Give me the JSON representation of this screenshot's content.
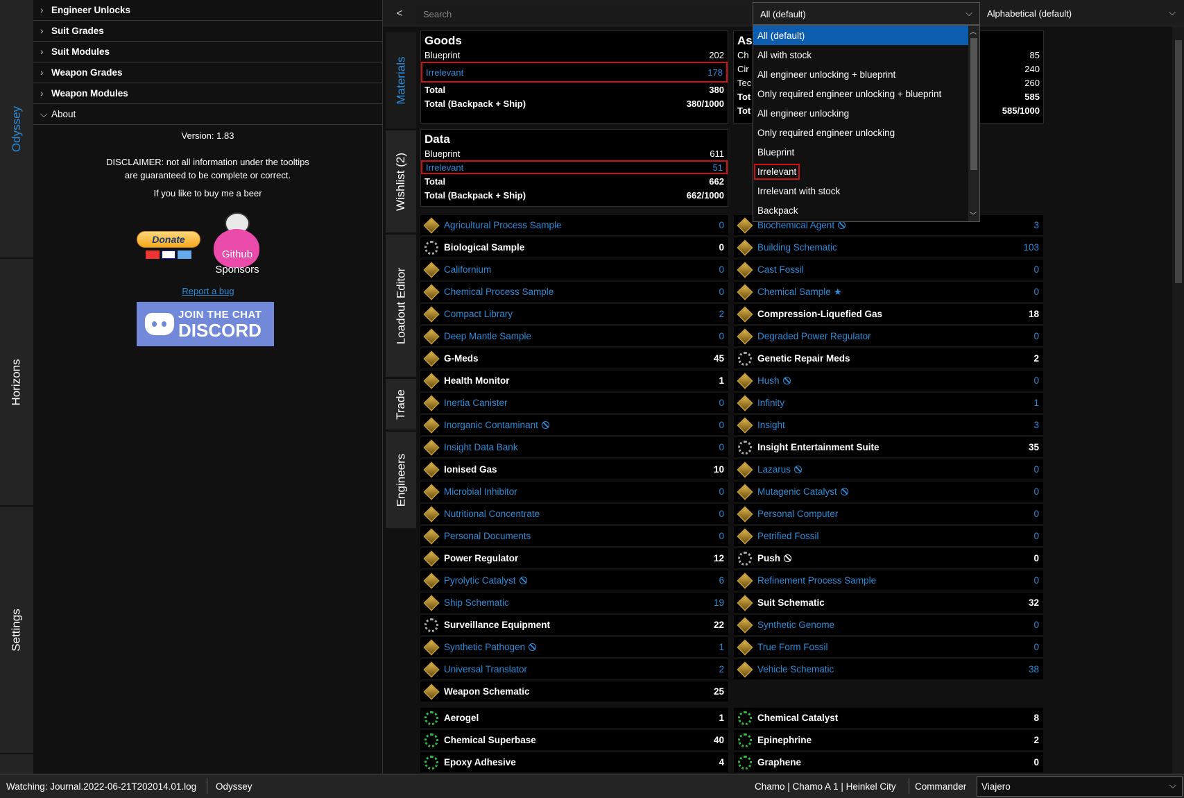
{
  "left_tabs": [
    "Odyssey",
    "Horizons",
    "Settings"
  ],
  "accordion": [
    {
      "label": "Engineer Unlocks",
      "open": false
    },
    {
      "label": "Suit Grades",
      "open": false
    },
    {
      "label": "Suit Modules",
      "open": false
    },
    {
      "label": "Weapon Grades",
      "open": false
    },
    {
      "label": "Weapon Modules",
      "open": false
    },
    {
      "label": "About",
      "open": true
    }
  ],
  "about": {
    "version": "Version: 1.83",
    "disclaimer1": "DISCLAIMER: not all information under the tooltips",
    "disclaimer2": "are guaranteed to be complete or correct.",
    "beer": "If you like to buy me a beer",
    "donate": "Donate",
    "github": "Github",
    "sponsors": "Sponsors",
    "report": "Report a bug",
    "discord1": "JOIN THE CHAT",
    "discord2": "DISCORD"
  },
  "topbar": {
    "back": "<",
    "search_placeholder": "Search",
    "filter": "All (default)",
    "sort": "Alphabetical (default)"
  },
  "mid_tabs": [
    "Materials",
    "Wishlist (2)",
    "Loadout Editor",
    "Trade",
    "Engineers"
  ],
  "goods": {
    "title": "Goods",
    "rows": [
      {
        "label": "Blueprint",
        "value": "202"
      },
      {
        "label": "Irrelevant",
        "value": "178"
      },
      {
        "label": "",
        "value": ""
      },
      {
        "label": "Total",
        "value": "380"
      },
      {
        "label": "Total (Backpack + Ship)",
        "value": "380/1000"
      }
    ]
  },
  "assets": {
    "title": "As",
    "rows": [
      {
        "label": "Ch",
        "value": "85"
      },
      {
        "label": "Cir",
        "value": "240"
      },
      {
        "label": "Tec",
        "value": "260"
      },
      {
        "label": "Tot",
        "value": "585"
      },
      {
        "label": "Tot",
        "value": "585/1000"
      }
    ]
  },
  "data": {
    "title": "Data",
    "rows": [
      {
        "label": "Blueprint",
        "value": "611"
      },
      {
        "label": "Irrelevant",
        "value": "51"
      },
      {
        "label": "Total",
        "value": "662"
      },
      {
        "label": "Total (Backpack + Ship)",
        "value": "662/1000"
      }
    ]
  },
  "dropdown": [
    "All (default)",
    "All with stock",
    "All engineer unlocking + blueprint",
    "Only required engineer unlocking + blueprint",
    "All engineer unlocking",
    "Only required engineer unlocking",
    "Blueprint",
    "Irrelevant",
    "Irrelevant with stock",
    "Backpack"
  ],
  "left_items": [
    {
      "name": "Agricultural Process Sample",
      "count": "0",
      "icon": "cube"
    },
    {
      "name": "Biological Sample",
      "count": "0",
      "icon": "gear",
      "bold": true
    },
    {
      "name": "Californium",
      "count": "0",
      "icon": "cube"
    },
    {
      "name": "Chemical Process Sample",
      "count": "0",
      "icon": "cube"
    },
    {
      "name": "Compact Library",
      "count": "2",
      "icon": "cube"
    },
    {
      "name": "Deep Mantle Sample",
      "count": "0",
      "icon": "cube"
    },
    {
      "name": "G-Meds",
      "count": "45",
      "icon": "cube",
      "bold": true
    },
    {
      "name": "Health Monitor",
      "count": "1",
      "icon": "cube",
      "bold": true
    },
    {
      "name": "Inertia Canister",
      "count": "0",
      "icon": "cube"
    },
    {
      "name": "Inorganic Contaminant",
      "count": "0",
      "icon": "cube",
      "block": true
    },
    {
      "name": "Insight Data Bank",
      "count": "0",
      "icon": "cube"
    },
    {
      "name": "Ionised Gas",
      "count": "10",
      "icon": "cube",
      "bold": true
    },
    {
      "name": "Microbial Inhibitor",
      "count": "0",
      "icon": "cube"
    },
    {
      "name": "Nutritional Concentrate",
      "count": "0",
      "icon": "cube"
    },
    {
      "name": "Personal Documents",
      "count": "0",
      "icon": "cube"
    },
    {
      "name": "Power Regulator",
      "count": "12",
      "icon": "cube",
      "bold": true
    },
    {
      "name": "Pyrolytic Catalyst",
      "count": "6",
      "icon": "cube",
      "block": true
    },
    {
      "name": "Ship Schematic",
      "count": "19",
      "icon": "cube"
    },
    {
      "name": "Surveillance Equipment",
      "count": "22",
      "icon": "gear",
      "bold": true
    },
    {
      "name": "Synthetic Pathogen",
      "count": "1",
      "icon": "cube",
      "block": true
    },
    {
      "name": "Universal Translator",
      "count": "2",
      "icon": "cube"
    },
    {
      "name": "Weapon Schematic",
      "count": "25",
      "icon": "cube",
      "bold": true
    }
  ],
  "right_items": [
    {
      "name": "Biochemical Agent",
      "count": "3",
      "icon": "cube",
      "block": true
    },
    {
      "name": "Building Schematic",
      "count": "103",
      "icon": "cube"
    },
    {
      "name": "Cast Fossil",
      "count": "0",
      "icon": "cube"
    },
    {
      "name": "Chemical Sample",
      "count": "0",
      "icon": "cube",
      "star": true
    },
    {
      "name": "Compression-Liquefied Gas",
      "count": "18",
      "icon": "cube",
      "bold": true
    },
    {
      "name": "Degraded Power Regulator",
      "count": "0",
      "icon": "cube"
    },
    {
      "name": "Genetic Repair Meds",
      "count": "2",
      "icon": "gear",
      "bold": true
    },
    {
      "name": "Hush",
      "count": "0",
      "icon": "cube",
      "block": true
    },
    {
      "name": "Infinity",
      "count": "1",
      "icon": "cube"
    },
    {
      "name": "Insight",
      "count": "3",
      "icon": "cube"
    },
    {
      "name": "Insight Entertainment Suite",
      "count": "35",
      "icon": "gear",
      "bold": true
    },
    {
      "name": "Lazarus",
      "count": "0",
      "icon": "cube",
      "block": true
    },
    {
      "name": "Mutagenic Catalyst",
      "count": "0",
      "icon": "cube",
      "block": true
    },
    {
      "name": "Personal Computer",
      "count": "0",
      "icon": "cube"
    },
    {
      "name": "Petrified Fossil",
      "count": "0",
      "icon": "cube"
    },
    {
      "name": "Push",
      "count": "0",
      "icon": "gear",
      "bold": true,
      "block": true
    },
    {
      "name": "Refinement Process Sample",
      "count": "0",
      "icon": "cube"
    },
    {
      "name": "Suit Schematic",
      "count": "32",
      "icon": "cube",
      "bold": true
    },
    {
      "name": "Synthetic Genome",
      "count": "0",
      "icon": "cube"
    },
    {
      "name": "True Form Fossil",
      "count": "0",
      "icon": "cube"
    },
    {
      "name": "Vehicle Schematic",
      "count": "38",
      "icon": "cube"
    }
  ],
  "chem_left": [
    {
      "name": "Aerogel",
      "count": "1"
    },
    {
      "name": "Chemical Superbase",
      "count": "40"
    },
    {
      "name": "Epoxy Adhesive",
      "count": "4"
    }
  ],
  "chem_right": [
    {
      "name": "Chemical Catalyst",
      "count": "8"
    },
    {
      "name": "Epinephrine",
      "count": "2"
    },
    {
      "name": "Graphene",
      "count": "0"
    }
  ],
  "status": {
    "watching": "Watching: Journal.2022-06-21T202014.01.log",
    "mode": "Odyssey",
    "location": "Chamo | Chamo A 1 | Heinkel City",
    "commander_label": "Commander",
    "commander": "Viajero"
  }
}
